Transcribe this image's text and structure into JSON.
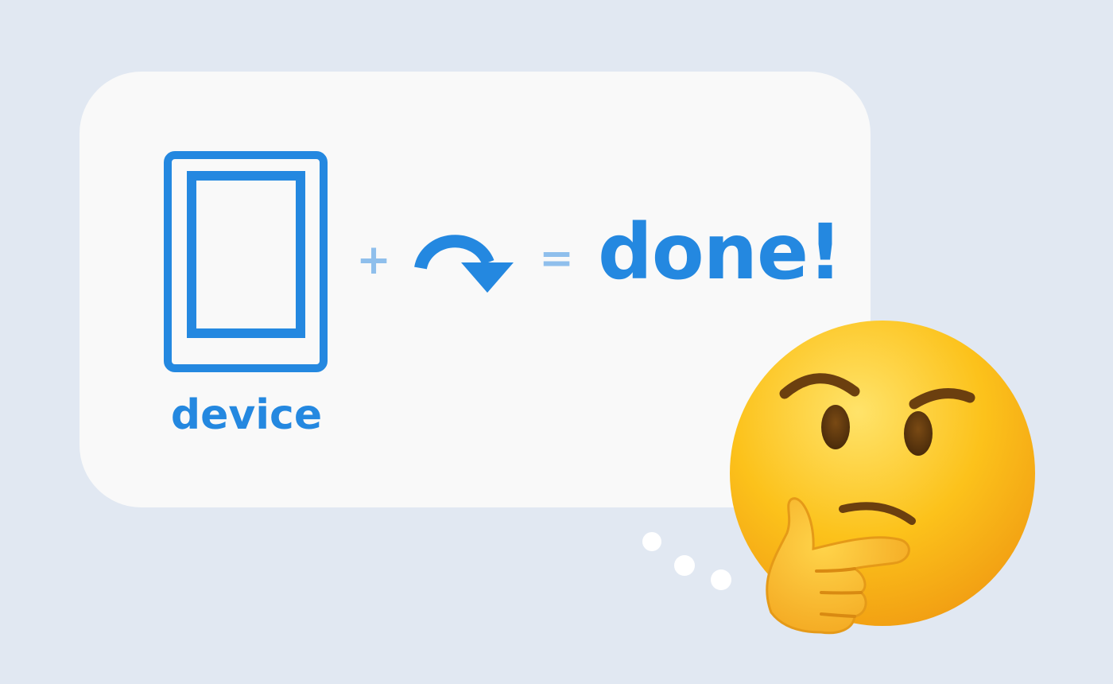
{
  "device_label": "device",
  "plus": "+",
  "equals": "=",
  "result": "done!",
  "icons": {
    "device": "tablet-device-icon",
    "rotate": "rotate-clockwise-arrow-icon",
    "emoji": "thinking-face-emoji"
  },
  "colors": {
    "background": "#e1e8f2",
    "bubble": "#f9f9f9",
    "accent": "#2488e0",
    "operator": "#8fbfec",
    "emoji_face": "#fcc21b"
  }
}
